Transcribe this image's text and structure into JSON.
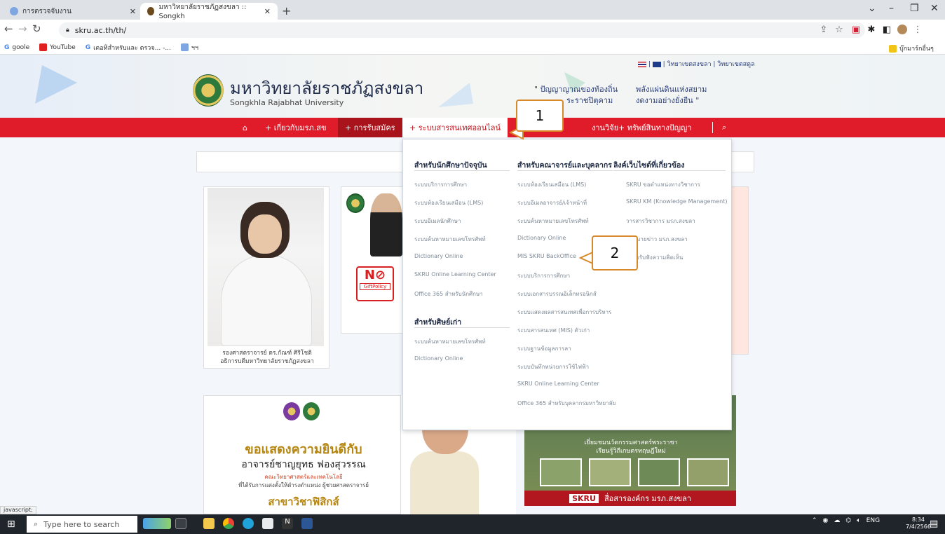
{
  "browser": {
    "tabs": [
      {
        "label": "การตรวจจับงาน",
        "active": false
      },
      {
        "label": "มหาวิทยาลัยราชภัฏสงขลา :: Songkh",
        "active": true
      }
    ],
    "url": "skru.ac.th/th/",
    "bookmarks": [
      "goole",
      "YouTube",
      "เคอทิสำหรับและ ตรวจ... -...",
      "ฯฯ"
    ],
    "bookmark_folder": "บุ๊กมาร์กอื่นๆ",
    "status_url": "javascript;"
  },
  "header": {
    "lang_links": "| วิทยาเขตสงขลา | วิทยาเขตสตูล",
    "university_th": "มหาวิทยาลัยราชภัฏสงขลา",
    "university_en": "Songkhla Rajabhat University",
    "slogan_left_1": "\" ปัญญาญาณของท้องถิ่น",
    "slogan_left_2": "ระราชปิตุคาม",
    "slogan_right_1": "พลังแผ่นดินแห่งสยาม",
    "slogan_right_2": "งดงามอย่างยั่งยืน \""
  },
  "nav": {
    "home_icon": "home-icon",
    "items": [
      "+ เกี่ยวกับมรภ.สข",
      "+ การรับสมัคร",
      "+ ระบบสารสนเทศออนไลน์",
      "งานวิจัย",
      "+ ทรัพย์สินทางปัญญา"
    ],
    "search_icon": "search-icon"
  },
  "dropdown": {
    "col1_title": "สำหรับนักศึกษาปัจจุบัน",
    "col1_links": [
      "ระบบบริการการศึกษา",
      "ระบบห้องเรียนเสมือน (LMS)",
      "ระบบอีเมลนักศึกษา",
      "ระบบค้นหาหมายเลขโทรศัพท์",
      "Dictionary Online",
      "SKRU Online Learning Center",
      "Office 365 สำหรับนักศึกษา"
    ],
    "col1b_title": "สำหรับศิษย์เก่า",
    "col1b_links": [
      "ระบบค้นหาหมายเลขโทรศัพท์",
      "Dictionary Online"
    ],
    "col2_title": "สำหรับคณาจารย์และบุคลากร",
    "col2_links": [
      "ระบบห้องเรียนเสมือน (LMS)",
      "ระบบอีเมลอาจารย์/เจ้าหน้าที่",
      "ระบบค้นหาหมายเลขโทรศัพท์",
      "Dictionary Online",
      "MIS SKRU BackOffice",
      "ระบบบริการการศึกษา",
      "ระบบเอกสารบรรณอิเล็กทรอนิกส์",
      "ระบบแสดงผลสารสนเทศเพื่อการบริหาร",
      "ระบบสารสนเทศ (MIS) ตัวเก่า",
      "ระบบฐานข้อมูลการลา",
      "ระบบบันทึกหน่วยการใช้ไฟฟ้า",
      "SKRU Online Learning Center",
      "Office 365 สำหรับบุคลากรมหาวิทยาลัย"
    ],
    "col3_title": "ลิงค์เว็บไซต์ที่เกี่ยวข้อง",
    "col3_links": [
      "SKRU ขอตำแหน่งทางวิชาการ",
      "SKRU KM (Knowledge Management)",
      "วารสารวิชาการ มรภ.สงขลา",
      "จดหมายข่าว มรภ.สงขลา",
      "ระบบรับฟังความคิดเห็น"
    ]
  },
  "callouts": [
    "1",
    "2"
  ],
  "content": {
    "president_caption_1": "รองศาสตราจารย์ ดร.กัณฑ์ ศิริโชติ",
    "president_caption_2": "อธิการบดีมหาวิทยาลัยราชภัฏสงขลา",
    "gift_policy": "GiftPolicy",
    "banner1_title": "ขอแสดงความยินดีกับ",
    "banner1_name": "อาจารย์ชาญยุทธ ฟองสุวรรณ",
    "banner1_sub1": "คณะวิทยาศาสตร์และเทคโนโลยี",
    "banner1_sub2": "ที่ได้รับการแต่งตั้งให้ดำรงตำแหน่ง ผู้ช่วยศาสตราจารย์",
    "banner1_sub3": "สาขาวิชาฟิสิกส์",
    "banner3_text_1": "เยี่ยมชมนวัตกรรมศาสตร์พระราชา",
    "banner3_text_2": "เรียนรู้วิถีเกษตรทฤษฎีใหม่",
    "banner3_logo": "SKRU",
    "banner3_footer": "สื่อสารองค์กร มรภ.สงขลา"
  },
  "taskbar": {
    "search_placeholder": "Type here to search",
    "tray_lang": "ENG",
    "time": "8:34",
    "date": "7/4/2566"
  },
  "colors": {
    "nav_red": "#e01c2b",
    "nav_dark_red": "#a8131c",
    "callout_border": "#d88a2b"
  }
}
